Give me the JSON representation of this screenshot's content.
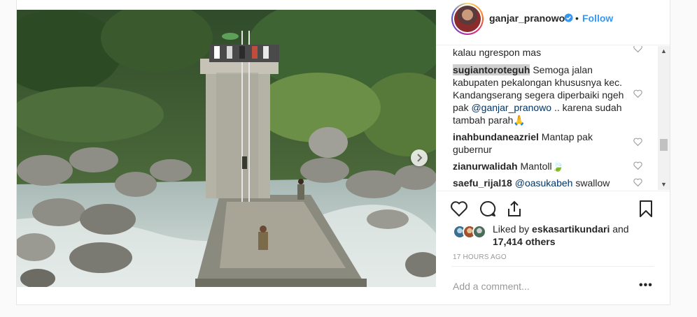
{
  "post": {
    "username": "ganjar_pranowo",
    "follow_label": "Follow",
    "separator": "•",
    "next_icon": "chevron-right-icon",
    "photo_icon": "bridge-photo"
  },
  "comments": [
    {
      "username": "",
      "text": "kalau ngrespon mas",
      "top": 0
    },
    {
      "username": "sugiantoroteguh",
      "text_before": " Semoga jalan kabupaten pekalongan khususnya kec. Kandangserang segera diperbaiki ngeh pak ",
      "mention": "@ganjar_pranowo",
      "text_after": " .. karena sudah tambah parah🙏"
    },
    {
      "username": "inahbundaneazriel",
      "text": " Mantap pak gubernur"
    },
    {
      "username": "zianurwalidah",
      "text": " Mantoll🍃"
    },
    {
      "username": "saefu_rijal18",
      "mention": "@oasukabeh",
      "text": " swallow"
    }
  ],
  "likes": {
    "prefix": "Liked by ",
    "user": "eskasartikundari",
    "middle": " and",
    "count": "17,414 others"
  },
  "timestamp": "17 HOURS AGO",
  "add_comment_placeholder": "Add a comment...",
  "more_label": "•••",
  "colors": {
    "link": "#3897f0",
    "mention": "#003569",
    "meta": "#999999"
  }
}
